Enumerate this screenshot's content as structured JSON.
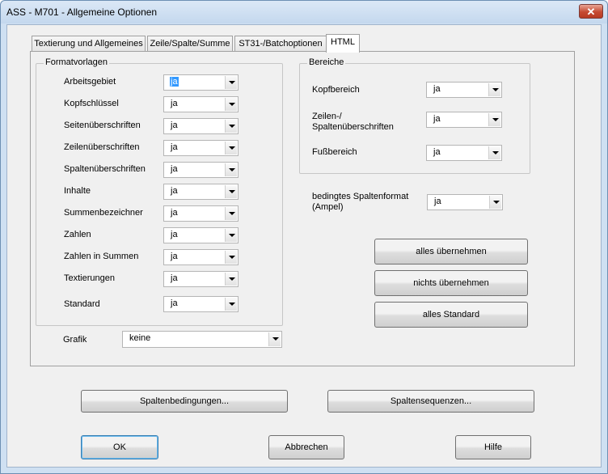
{
  "window": {
    "title": "ASS - M701 - Allgemeine Optionen",
    "close_label": "✕"
  },
  "tabs": [
    {
      "label": "Textierung und Allgemeines"
    },
    {
      "label": "Zeile/Spalte/Summe"
    },
    {
      "label": "ST31-/Batchoptionen"
    },
    {
      "label": "HTML",
      "active": true
    }
  ],
  "formatvorlagen": {
    "title": "Formatvorlagen",
    "rows": [
      {
        "label": "Arbeitsgebiet",
        "value": "ja"
      },
      {
        "label": "Kopfschlüssel",
        "value": "ja"
      },
      {
        "label": "Seitenüberschriften",
        "value": "ja"
      },
      {
        "label": "Zeilenüberschriften",
        "value": "ja"
      },
      {
        "label": "Spaltenüberschriften",
        "value": "ja"
      },
      {
        "label": "Inhalte",
        "value": "ja"
      },
      {
        "label": "Summenbezeichner",
        "value": "ja"
      },
      {
        "label": "Zahlen",
        "value": "ja"
      },
      {
        "label": "Zahlen in Summen",
        "value": "ja"
      },
      {
        "label": "Textierungen",
        "value": "ja"
      },
      {
        "label": "Standard",
        "value": "ja"
      }
    ]
  },
  "grafik": {
    "label": "Grafik",
    "value": "keine"
  },
  "bereiche": {
    "title": "Bereiche",
    "kopf": {
      "label": "Kopfbereich",
      "value": "ja"
    },
    "zeilen": {
      "label_line1": "Zeilen-/",
      "label_line2": "Spaltenüberschriften",
      "value": "ja"
    },
    "fuss": {
      "label": "Fußbereich",
      "value": "ja"
    }
  },
  "bedingt": {
    "label_line1": "bedingtes Spaltenformat",
    "label_line2": "(Ampel)",
    "value": "ja"
  },
  "action_buttons": {
    "alles_uebernehmen": "alles übernehmen",
    "nichts_uebernehmen": "nichts übernehmen",
    "alles_standard": "alles Standard"
  },
  "lower_buttons": {
    "spaltenbedingungen": "Spaltenbedingungen...",
    "spaltensequenzen": "Spaltensequenzen..."
  },
  "footer_buttons": {
    "ok": "OK",
    "abbrechen": "Abbrechen",
    "hilfe": "Hilfe"
  }
}
